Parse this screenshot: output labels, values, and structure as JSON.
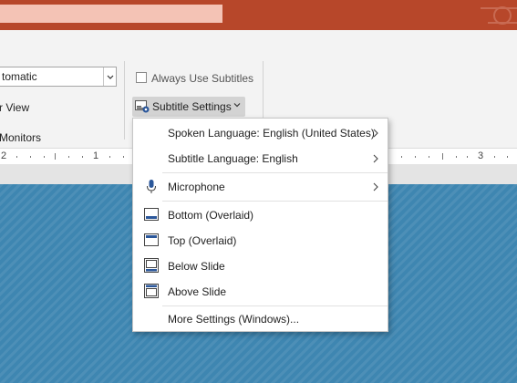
{
  "titlebar": {
    "search_value": ""
  },
  "ribbon": {
    "monitor_select_value": "tomatic",
    "view_text": "r View",
    "group_label": "Monitors",
    "always_use_subtitles_label": "Always Use Subtitles",
    "always_use_subtitles_checked": false,
    "subtitle_settings_label": "Subtitle Settings"
  },
  "ruler": {
    "labels": [
      "2",
      "1",
      "3"
    ]
  },
  "menu": {
    "items": [
      {
        "label": "Spoken Language: English (United States)",
        "icon": "",
        "has_submenu": true
      },
      {
        "label": "Subtitle Language: English",
        "icon": "",
        "has_submenu": true
      },
      {
        "label": "Microphone",
        "icon": "microphone-icon",
        "has_submenu": true
      },
      {
        "label": "Bottom (Overlaid)",
        "icon": "bottom-overlaid-icon",
        "has_submenu": false
      },
      {
        "label": "Top (Overlaid)",
        "icon": "top-overlaid-icon",
        "has_submenu": false
      },
      {
        "label": "Below Slide",
        "icon": "below-slide-icon",
        "has_submenu": false
      },
      {
        "label": "Above Slide",
        "icon": "above-slide-icon",
        "has_submenu": false
      },
      {
        "label": "More Settings (Windows)...",
        "icon": "",
        "has_submenu": false
      }
    ]
  },
  "colors": {
    "titlebar": "#b7472a",
    "slide": "#3e86b1",
    "menu_accent": "#2b579a"
  }
}
